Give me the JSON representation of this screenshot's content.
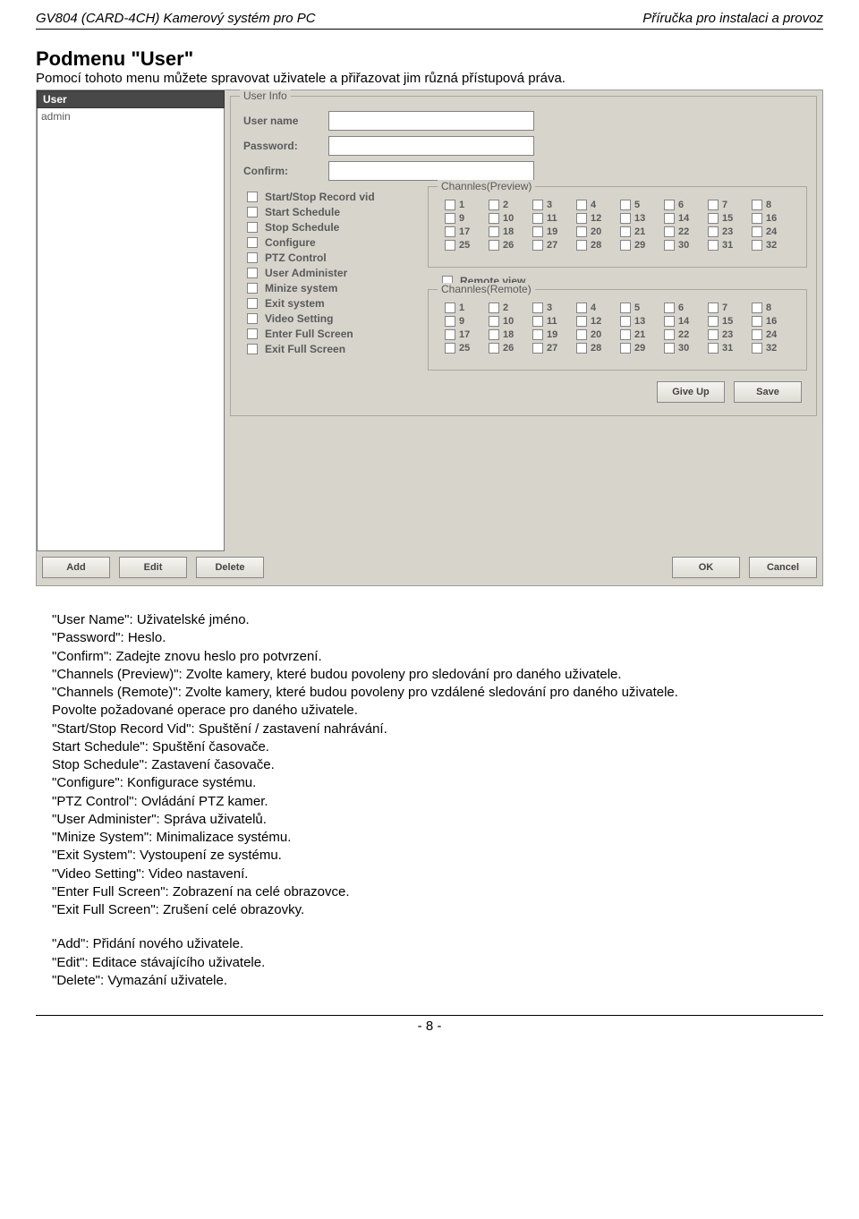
{
  "header": {
    "left_prefix": "GV804 (CARD-4CH)",
    "left_suffix": "  Kamerový systém pro PC",
    "right": "Příručka pro instalaci a provoz"
  },
  "title": "Podmenu \"User\"",
  "intro": "Pomocí tohoto menu můžete spravovat uživatele a přiřazovat jim různá přístupová práva.",
  "app": {
    "user_header": "User",
    "user_list": [
      "admin"
    ],
    "user_info_legend": "User Info",
    "labels": {
      "user_name": "User name",
      "password": "Password:",
      "confirm": "Confirm:"
    },
    "values": {
      "user_name": "",
      "password": "",
      "confirm": ""
    },
    "permissions": [
      "Start/Stop Record vid",
      "Start Schedule",
      "Stop Schedule",
      "Configure",
      "PTZ Control",
      "User Administer",
      "Minize system",
      "Exit system",
      "Video Setting",
      "Enter Full Screen",
      "Exit Full Screen"
    ],
    "channels_preview_legend": "Channles(Preview)",
    "channels_remote_legend": "Channles(Remote)",
    "remote_view_label": "Remote view",
    "channels": [
      "1",
      "2",
      "3",
      "4",
      "5",
      "6",
      "7",
      "8",
      "9",
      "10",
      "11",
      "12",
      "13",
      "14",
      "15",
      "16",
      "17",
      "18",
      "19",
      "20",
      "21",
      "22",
      "23",
      "24",
      "25",
      "26",
      "27",
      "28",
      "29",
      "30",
      "31",
      "32"
    ],
    "buttons": {
      "give_up": "Give Up",
      "save": "Save",
      "add": "Add",
      "edit": "Edit",
      "delete": "Delete",
      "ok": "OK",
      "cancel": "Cancel"
    }
  },
  "desc": {
    "lines1": [
      "\"User Name\": Uživatelské jméno.",
      "\"Password\": Heslo.",
      "\"Confirm\": Zadejte znovu heslo pro potvrzení.",
      "\"Channels (Preview)\": Zvolte kamery, které budou povoleny pro sledování pro daného uživatele.",
      "\"Channels (Remote)\": Zvolte kamery, které budou povoleny pro vzdálené sledování pro daného uživatele.",
      "Povolte požadované operace pro daného uživatele.",
      "\"Start/Stop Record Vid\": Spuštění / zastavení nahrávání.",
      "Start Schedule\": Spuštění časovače.",
      "Stop Schedule\": Zastavení časovače.",
      "\"Configure\": Konfigurace systému.",
      "\"PTZ Control\": Ovládání PTZ kamer.",
      "\"User Administer\": Správa uživatelů.",
      "\"Minize System\": Minimalizace systému.",
      "\"Exit System\": Vystoupení ze systému.",
      "\"Video Setting\": Video nastavení.",
      "\"Enter Full Screen\": Zobrazení na celé obrazovce.",
      "\"Exit Full Screen\": Zrušení celé obrazovky."
    ],
    "lines2": [
      "\"Add\": Přidání nového uživatele.",
      "\"Edit\": Editace stávajícího uživatele.",
      "\"Delete\": Vymazání uživatele."
    ]
  },
  "footer": "- 8 -"
}
